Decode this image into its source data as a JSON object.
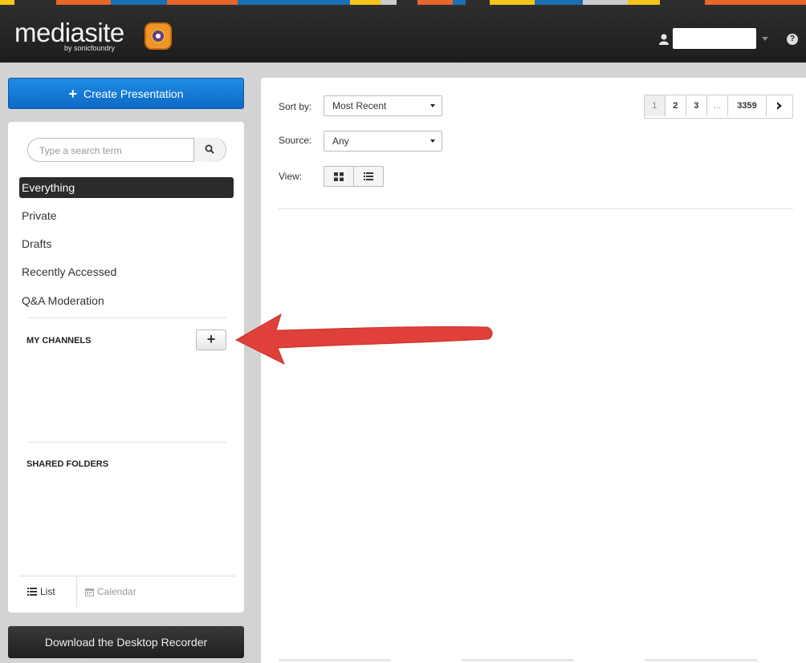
{
  "header": {
    "logo_text": "mediasite",
    "logo_subtext": "by sonicfoundry",
    "help_symbol": "?",
    "user_name": "",
    "colors": {
      "bar": "#1d1d1d",
      "strip": [
        "#f5c518",
        "#e8652b",
        "#1a6fb6",
        "#2e2e2e",
        "#e8652b",
        "#1a6fb6",
        "#f5c518",
        "#cccccc",
        "#2e2e2e",
        "#e8652b",
        "#1a6fb6",
        "#f5c518"
      ]
    }
  },
  "sidebar": {
    "create_label": "Create Presentation",
    "create_symbol": "+",
    "search_placeholder": "Type a search term",
    "search_value": "",
    "nav": [
      {
        "label": "Everything",
        "active": true
      },
      {
        "label": "Private"
      },
      {
        "label": "Drafts"
      },
      {
        "label": "Recently Accessed"
      },
      {
        "label": "Q&A Moderation"
      }
    ],
    "my_channels_title": "MY CHANNELS",
    "add_channel_symbol": "+",
    "shared_folders_title": "SHARED FOLDERS",
    "view_tabs": {
      "list": "List",
      "calendar": "Calendar"
    },
    "download_label": "Download the Desktop Recorder",
    "accent_color": "#1a7fd8"
  },
  "main": {
    "sort_label": "Sort by:",
    "sort_value": "Most Recent",
    "source_label": "Source:",
    "source_value": "Any",
    "view_label": "View:",
    "view_modes": [
      "grid-icon",
      "list-icon"
    ],
    "pagination": [
      "1",
      "2",
      "3",
      "...",
      "3359"
    ],
    "current_page": "1"
  },
  "annotation": {
    "type": "arrow",
    "color": "#e0403a",
    "points_to": "add-channel-button"
  }
}
